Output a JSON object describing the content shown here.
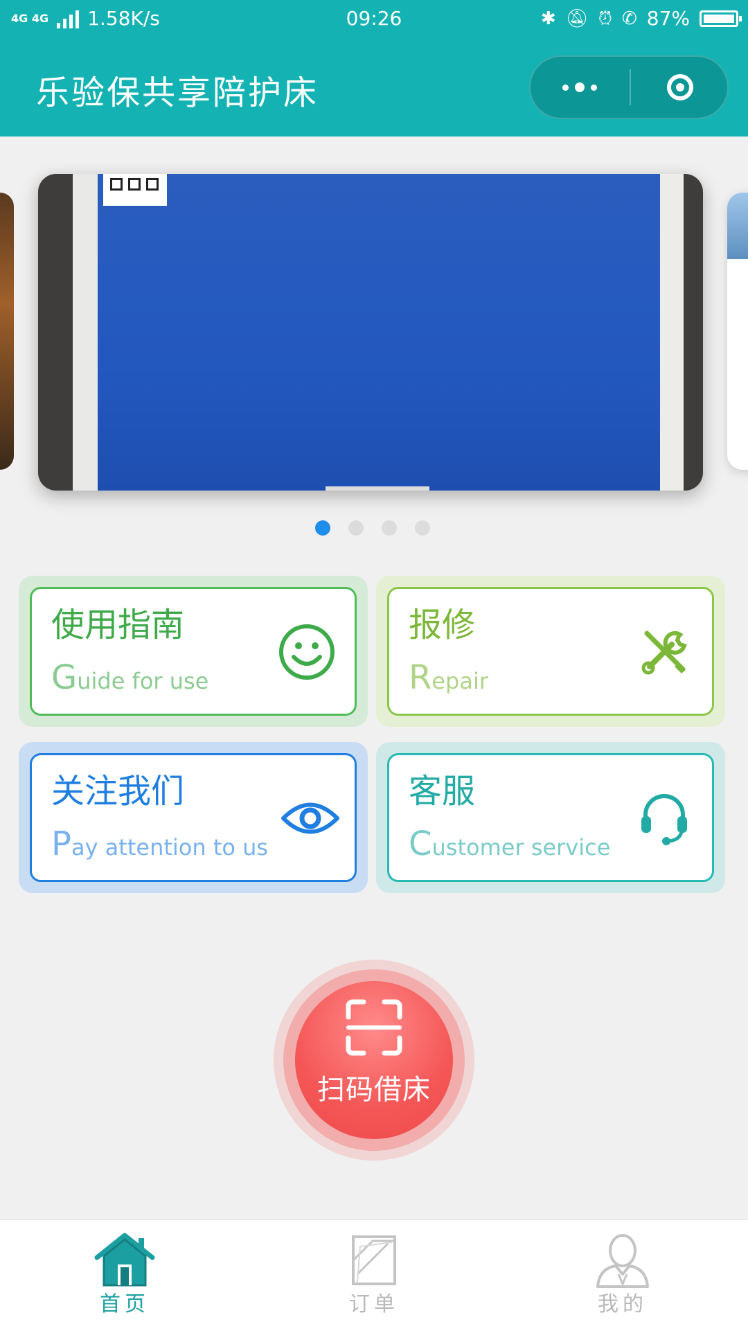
{
  "status_bar": {
    "network": "4G 4G",
    "speed": "1.58K/s",
    "time": "09:26",
    "icons": [
      "bluetooth-icon",
      "mute-icon",
      "alarm-icon",
      "hd-call-icon"
    ],
    "battery": "87%",
    "battery_level": 0.87
  },
  "nav": {
    "title": "乐验保共享陪护床",
    "more_icon": "more-dots-icon",
    "close_icon": "target-close-icon"
  },
  "banner": {
    "slide_count": 4,
    "active_index": 0
  },
  "cards": [
    {
      "id": "guide",
      "title": "使用指南",
      "subtitle_cap": "G",
      "subtitle_rest": "uide for use",
      "icon": "smiley-icon",
      "color": "#4fbc58"
    },
    {
      "id": "repair",
      "title": "报修",
      "subtitle_cap": "R",
      "subtitle_rest": "epair",
      "icon": "wrench-screwdriver-icon",
      "color": "#8bc649"
    },
    {
      "id": "follow",
      "title": "关注我们",
      "subtitle_cap": "P",
      "subtitle_rest": "ay attention to us",
      "icon": "eye-icon",
      "color": "#1f7ee0"
    },
    {
      "id": "service",
      "title": "客服",
      "subtitle_cap": "C",
      "subtitle_rest": "ustomer service",
      "icon": "headset-icon",
      "color": "#28b9b2"
    }
  ],
  "scan": {
    "label": "扫码借床",
    "icon": "scan-frame-icon",
    "color": "#f45656"
  },
  "tabs": [
    {
      "label": "首页",
      "icon": "home-icon",
      "active": true,
      "color": "#1c9fa1"
    },
    {
      "label": "订单",
      "icon": "orders-icon",
      "active": false,
      "color": "#b9b9b9"
    },
    {
      "label": "我的",
      "icon": "profile-icon",
      "active": false,
      "color": "#b9b9b9"
    }
  ]
}
